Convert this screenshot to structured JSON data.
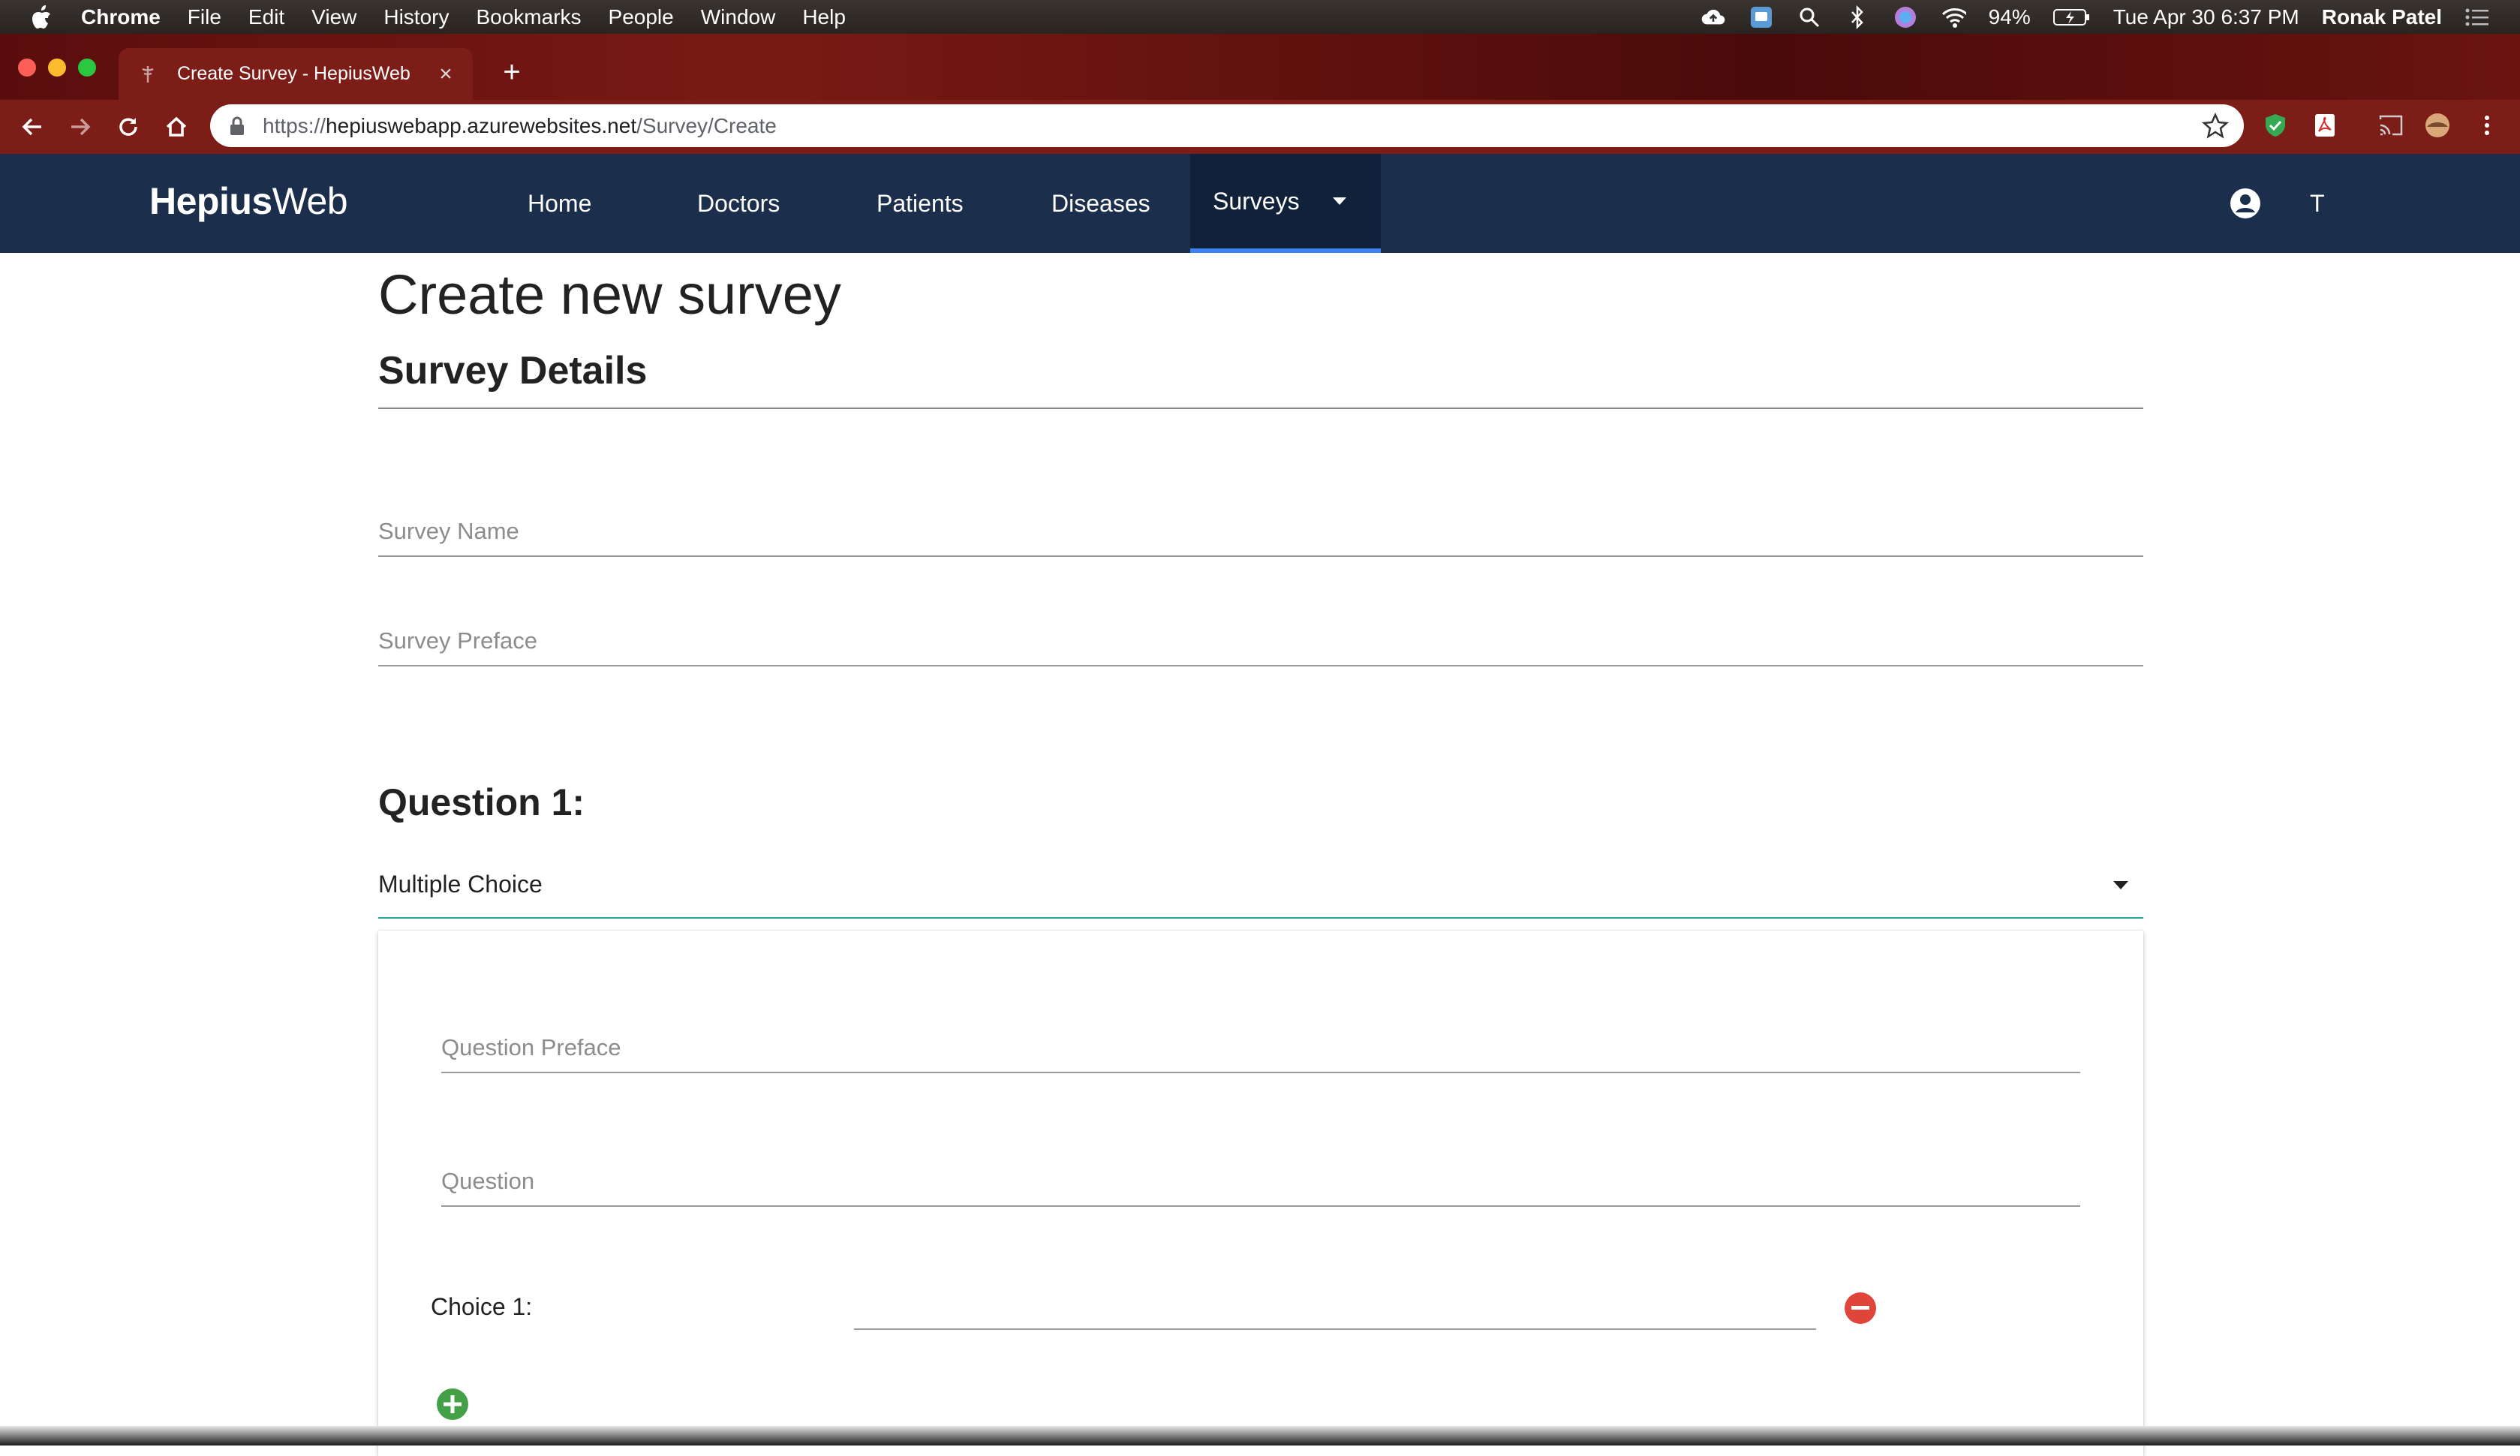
{
  "menubar": {
    "app": "Chrome",
    "items": [
      "File",
      "Edit",
      "View",
      "History",
      "Bookmarks",
      "People",
      "Window",
      "Help"
    ],
    "battery": "94%",
    "datetime": "Tue Apr 30  6:37 PM",
    "user": "Ronak Patel"
  },
  "browser": {
    "tab_title": "Create Survey - HepiusWeb",
    "url_scheme": "https://",
    "url_host": "hepiuswebapp.azurewebsites.net",
    "url_path": "/Survey/Create"
  },
  "appnav": {
    "brand_bold": "Hepius",
    "brand_light": "Web",
    "links": [
      "Home",
      "Doctors",
      "Patients",
      "Diseases",
      "Surveys"
    ],
    "active": "Surveys",
    "user_initial": "T"
  },
  "page": {
    "title": "Create new survey",
    "section": "Survey Details",
    "survey_name_placeholder": "Survey Name",
    "survey_preface_placeholder": "Survey Preface",
    "question_title": "Question 1:",
    "question_type": "Multiple Choice",
    "question_preface_placeholder": "Question Preface",
    "question_placeholder": "Question",
    "choice_label": "Choice 1:"
  },
  "colors": {
    "navbar": "#1b2e4b",
    "active_underline": "#3d82f5",
    "select_underline": "#26a69a",
    "remove_button": "#e0453a",
    "add_button": "#43a047"
  }
}
